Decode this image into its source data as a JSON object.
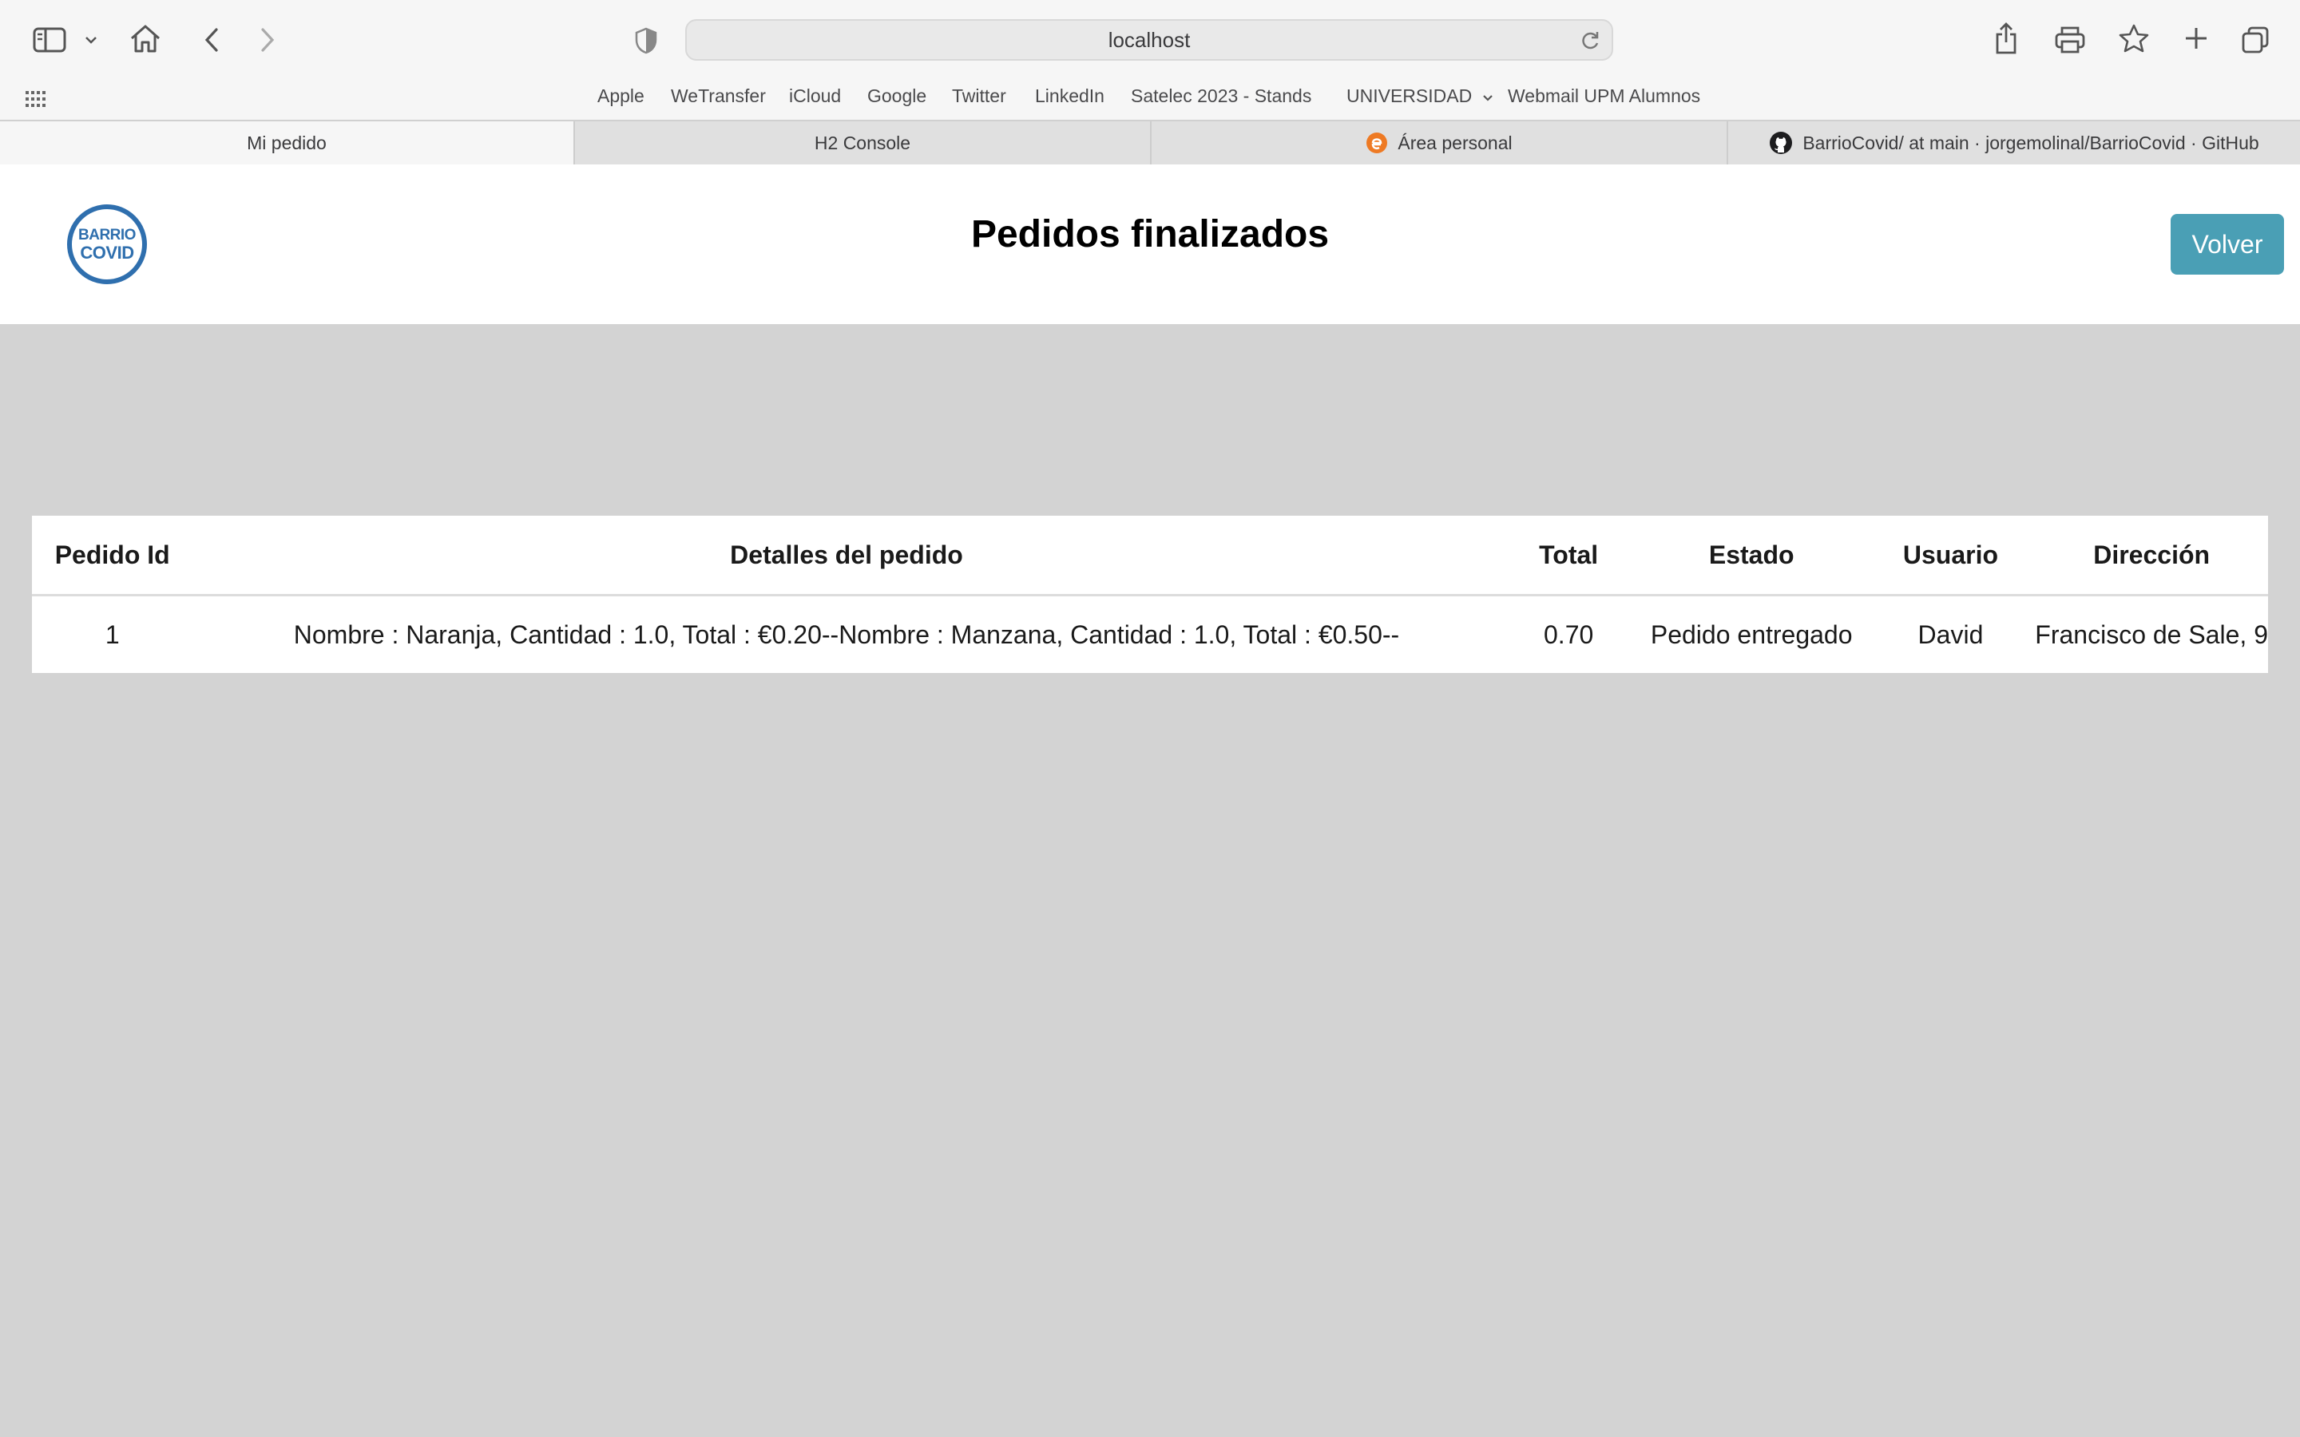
{
  "browser": {
    "url": "localhost",
    "bookmarks": [
      "Apple",
      "WeTransfer",
      "iCloud",
      "Google",
      "Twitter",
      "LinkedIn",
      "Satelec 2023 - Stands",
      "UNIVERSIDAD",
      "Webmail UPM Alumnos"
    ],
    "tabs": [
      "Mi pedido",
      "H2 Console",
      "Área personal",
      "BarrioCovid/ at main · jorgemolinal/BarrioCovid · GitHub"
    ],
    "active_tab": 0
  },
  "header": {
    "logo_line1": "BARRIO",
    "logo_line2": "COVID",
    "title": "Pedidos finalizados",
    "back_label": "Volver"
  },
  "colors": {
    "accent": "#4a9fb5",
    "logo": "#2f6fae",
    "page_background": "#d3d3d3"
  },
  "table": {
    "headers": [
      "Pedido Id",
      "Detalles del pedido",
      "Total",
      "Estado",
      "Usuario",
      "Dirección"
    ],
    "rows": [
      [
        "1",
        "Nombre : Naranja, Cantidad : 1.0, Total : €0.20--Nombre : Manzana, Cantidad : 1.0, Total : €0.50--",
        "0.70",
        "Pedido entregado",
        "David",
        "Francisco de Sale, 9"
      ]
    ]
  }
}
